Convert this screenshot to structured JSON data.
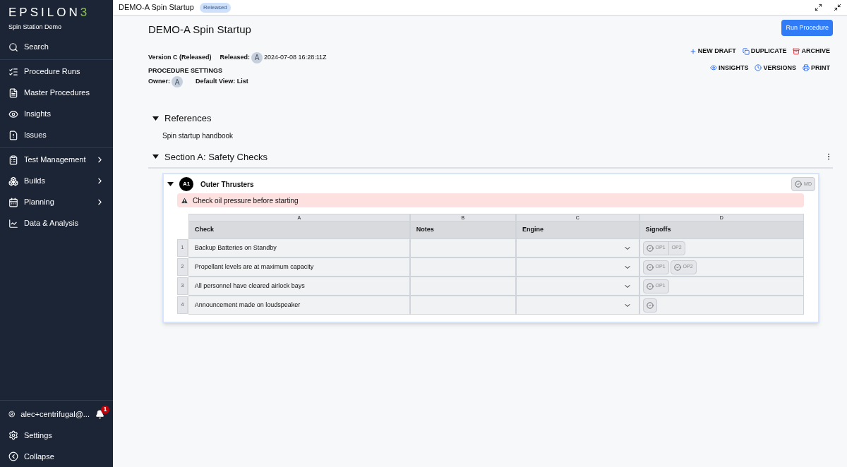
{
  "sidebar": {
    "logo": {
      "text": "EPSILON",
      "mark": "3"
    },
    "workspace": "Spin Station Demo",
    "sections": [
      [
        {
          "label": "Search",
          "has_submenu": false
        }
      ],
      [
        {
          "label": "Procedure Runs",
          "has_submenu": false
        },
        {
          "label": "Master Procedures",
          "has_submenu": false
        },
        {
          "label": "Insights",
          "has_submenu": false
        },
        {
          "label": "Issues",
          "has_submenu": false
        }
      ],
      [
        {
          "label": "Test Management",
          "has_submenu": true
        },
        {
          "label": "Builds",
          "has_submenu": true
        },
        {
          "label": "Planning",
          "has_submenu": true
        },
        {
          "label": "Data & Analysis",
          "has_submenu": false
        }
      ]
    ],
    "user": {
      "label": "alec+centrifugal@...",
      "notifications": "1"
    },
    "footer": [
      "Settings",
      "Collapse"
    ]
  },
  "topbar": {
    "title": "DEMO-A Spin Startup",
    "status": "Released"
  },
  "procedure": {
    "title": "DEMO-A Spin Startup",
    "run_button": "Run Procedure",
    "version": "Version C (Released)",
    "released_label": "Released:",
    "released_avatar": "A",
    "released_at": "2024-07-08 16:28:11Z",
    "settings_heading": "PROCEDURE SETTINGS",
    "owner_label": "Owner:",
    "owner_avatar": "A",
    "default_view": "Default View: List",
    "actions": [
      [
        "NEW DRAFT",
        "DUPLICATE",
        "ARCHIVE"
      ],
      [
        "INSIGHTS",
        "VERSIONS",
        "PRINT"
      ]
    ]
  },
  "references": {
    "title": "References",
    "expanded": true,
    "items": [
      "Spin startup handbook"
    ]
  },
  "section": {
    "title": "Section A: Safety Checks",
    "expanded": true,
    "step": {
      "badge": "A1",
      "title": "Outer Thrusters",
      "expanded": true,
      "signoff": "MD",
      "warning": "Check oil pressure before starting",
      "table": {
        "letters": [
          "A",
          "B",
          "C",
          "D"
        ],
        "columns": [
          "Check",
          "Notes",
          "Engine",
          "Signoffs"
        ],
        "rows": [
          {
            "number": "1",
            "check": "Backup Batteries on Standby",
            "signoffs": [
              [
                {
                  "label": "OP1",
                  "kind": "check"
                },
                {
                  "label": "OP2",
                  "kind": "text"
                }
              ]
            ]
          },
          {
            "number": "2",
            "check": "Propellant levels are at maximum capacity",
            "signoffs": [
              [
                {
                  "label": "OP1",
                  "kind": "check"
                }
              ],
              [
                {
                  "label": "OP2",
                  "kind": "check"
                }
              ]
            ]
          },
          {
            "number": "3",
            "check": "All personnel have cleared airlock bays",
            "signoffs": [
              [
                {
                  "label": "OP1",
                  "kind": "check"
                }
              ]
            ]
          },
          {
            "number": "4",
            "check": "Announcement made on loudspeaker",
            "signoffs": [
              [
                {
                  "kind": "check"
                }
              ]
            ]
          }
        ]
      }
    }
  }
}
